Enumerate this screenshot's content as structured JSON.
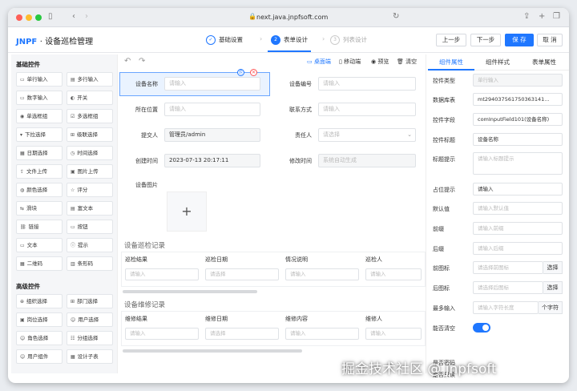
{
  "browser": {
    "url": "next.java.jnpfsoft.com"
  },
  "header": {
    "logo": "JNPF",
    "title": "· 设备巡检管理",
    "steps": [
      {
        "num": "✓",
        "label": "基础设置"
      },
      {
        "num": "2",
        "label": "表单设计"
      },
      {
        "num": "3",
        "label": "列表设计"
      }
    ],
    "buttons": {
      "prev": "上一步",
      "next": "下一步",
      "save": "保 存",
      "cancel": "取 消"
    }
  },
  "left": {
    "basic_title": "基础控件",
    "basic": [
      {
        "icon": "▭",
        "label": "单行输入"
      },
      {
        "icon": "▤",
        "label": "多行输入"
      },
      {
        "icon": "▭",
        "label": "数字输入"
      },
      {
        "icon": "◐",
        "label": "开关"
      },
      {
        "icon": "◉",
        "label": "单选框组"
      },
      {
        "icon": "☑",
        "label": "多选框组"
      },
      {
        "icon": "▾",
        "label": "下拉选择"
      },
      {
        "icon": "⊞",
        "label": "级联选择"
      },
      {
        "icon": "▦",
        "label": "日期选择"
      },
      {
        "icon": "◷",
        "label": "时间选择"
      },
      {
        "icon": "⇪",
        "label": "文件上传"
      },
      {
        "icon": "▣",
        "label": "图片上传"
      },
      {
        "icon": "◍",
        "label": "颜色选择"
      },
      {
        "icon": "☆",
        "label": "评分"
      },
      {
        "icon": "⇆",
        "label": "滑块"
      },
      {
        "icon": "▤",
        "label": "富文本"
      },
      {
        "icon": "⛓",
        "label": "链接"
      },
      {
        "icon": "▭",
        "label": "按钮"
      },
      {
        "icon": "▭",
        "label": "文本"
      },
      {
        "icon": "ⓘ",
        "label": "提示"
      },
      {
        "icon": "▦",
        "label": "二维码"
      },
      {
        "icon": "▥",
        "label": "条形码"
      }
    ],
    "adv_title": "高级控件",
    "advanced": [
      {
        "icon": "⊕",
        "label": "组织选择"
      },
      {
        "icon": "⊞",
        "label": "部门选择"
      },
      {
        "icon": "▣",
        "label": "岗位选择"
      },
      {
        "icon": "☺",
        "label": "用户选择"
      },
      {
        "icon": "☺",
        "label": "角色选择"
      },
      {
        "icon": "☷",
        "label": "分组选择"
      },
      {
        "icon": "☺",
        "label": "用户组件"
      },
      {
        "icon": "▦",
        "label": "设计子表"
      }
    ]
  },
  "canvas": {
    "toolbar": {
      "desktop": "▭ 桌面端",
      "mobile": "▯ 移动端",
      "preview": "◉ 预览",
      "clear": "🗑 清空"
    },
    "fields": {
      "device_name": {
        "label": "设备名称",
        "placeholder": "请输入"
      },
      "device_code": {
        "label": "设备编号",
        "placeholder": "请输入"
      },
      "location": {
        "label": "所在位置",
        "placeholder": "请输入"
      },
      "contact": {
        "label": "联系方式",
        "placeholder": "请输入"
      },
      "submitter": {
        "label": "提交人",
        "value": "管理员/admin"
      },
      "owner": {
        "label": "责任人",
        "placeholder": "请选择"
      },
      "created": {
        "label": "创建时间",
        "value": "2023-07-13 20:17:11"
      },
      "modified": {
        "label": "修改时间",
        "placeholder": "系统自动生成"
      },
      "image": {
        "label": "设备图片",
        "plus": "+"
      }
    },
    "inspect": {
      "title": "设备巡检记录",
      "cols": [
        {
          "head": "巡检结果",
          "ph": "请输入"
        },
        {
          "head": "巡检日期",
          "ph": "请选择"
        },
        {
          "head": "情况说明",
          "ph": "请输入"
        },
        {
          "head": "巡检人",
          "ph": "请输入"
        }
      ]
    },
    "repair": {
      "title": "设备维修记录",
      "cols": [
        {
          "head": "维修结果",
          "ph": "请输入"
        },
        {
          "head": "维修日期",
          "ph": "请选择"
        },
        {
          "head": "维修内容",
          "ph": "请输入"
        },
        {
          "head": "维修人",
          "ph": "请输入"
        }
      ]
    }
  },
  "right": {
    "tabs": [
      "组件属性",
      "组件样式",
      "表单属性"
    ],
    "props": [
      {
        "label": "控件类型",
        "value": "单行输入",
        "kind": "dis"
      },
      {
        "label": "数据库表",
        "value": "mt294037561750363141...",
        "kind": "val"
      },
      {
        "label": "控件字段",
        "value": "comInputField101(设备名称)",
        "kind": "val"
      },
      {
        "label": "控件标题",
        "value": "设备名称",
        "kind": "val"
      },
      {
        "label": "标题提示",
        "value": "请输入标题提示",
        "kind": "area"
      },
      {
        "label": "占位提示",
        "value": "请输入",
        "kind": "val"
      },
      {
        "label": "默认值",
        "value": "请输入默认值",
        "kind": "ph"
      },
      {
        "label": "前缀",
        "value": "请输入前缀",
        "kind": "ph"
      },
      {
        "label": "后缀",
        "value": "请输入后缀",
        "kind": "ph"
      },
      {
        "label": "前图标",
        "value": "请选择前图标",
        "kind": "btn",
        "btn": "选择"
      },
      {
        "label": "后图标",
        "value": "请选择后图标",
        "kind": "btn",
        "btn": "选择"
      },
      {
        "label": "最多输入",
        "value": "请输入字符长度",
        "kind": "btn",
        "btn": "个字符"
      },
      {
        "label": "能否清空",
        "value": "",
        "kind": "toggle"
      }
    ],
    "extra1": "是否密码",
    "extra2": "是否只读"
  },
  "watermark": "掘金技术社区 @ jnpfsoft"
}
